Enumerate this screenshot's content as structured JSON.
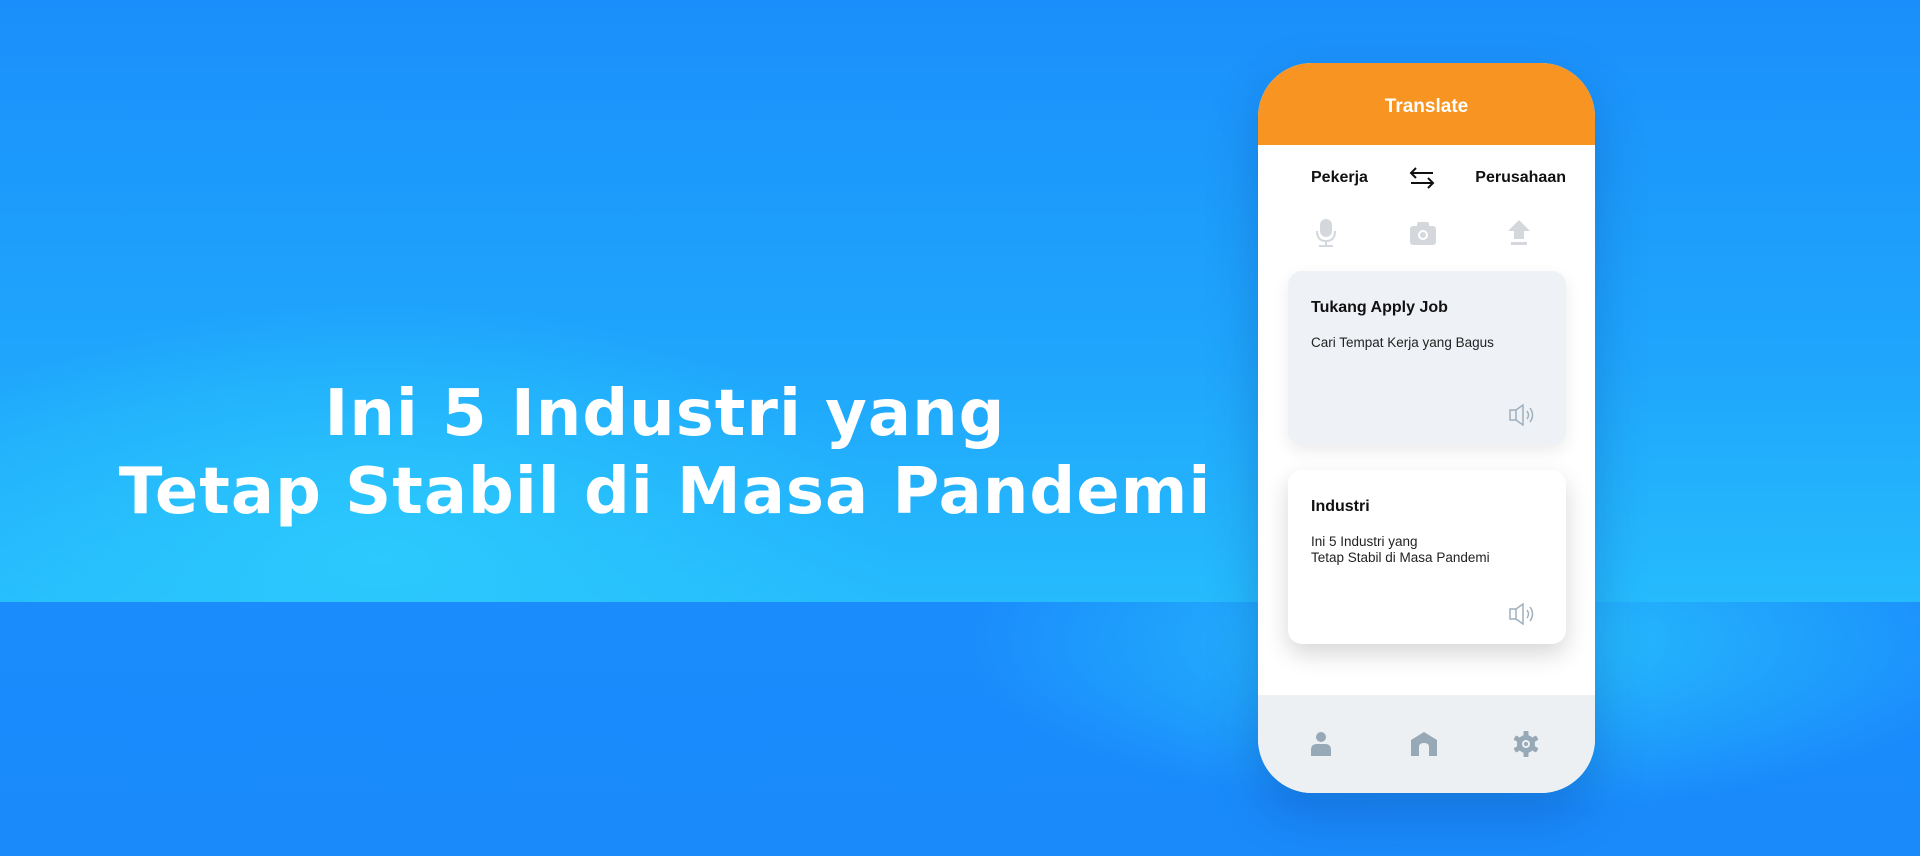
{
  "headline": {
    "line1": "Ini 5 Industri yang",
    "line2": "Tetap Stabil di Masa Pandemi"
  },
  "phone": {
    "header_title": "Translate",
    "accent_color": "#f79422",
    "source_language": "Pekerja",
    "target_language": "Perusahaan",
    "swap_icon": "swap-arrows-icon",
    "tools": [
      {
        "name": "microphone",
        "icon": "microphone-icon"
      },
      {
        "name": "camera",
        "icon": "camera-icon"
      },
      {
        "name": "upload",
        "icon": "upload-icon"
      }
    ],
    "cards": [
      {
        "title": "Tukang Apply Job",
        "text_lines": [
          "Cari Tempat Kerja yang Bagus"
        ],
        "icon": "speaker-icon"
      },
      {
        "title": "Industri",
        "text_lines": [
          "Ini 5 Industri yang",
          "Tetap Stabil di Masa Pandemi"
        ],
        "icon": "speaker-icon"
      }
    ],
    "bottom_nav": [
      {
        "name": "profile",
        "icon": "user-icon"
      },
      {
        "name": "home",
        "icon": "home-icon"
      },
      {
        "name": "settings",
        "icon": "gear-icon"
      }
    ]
  }
}
